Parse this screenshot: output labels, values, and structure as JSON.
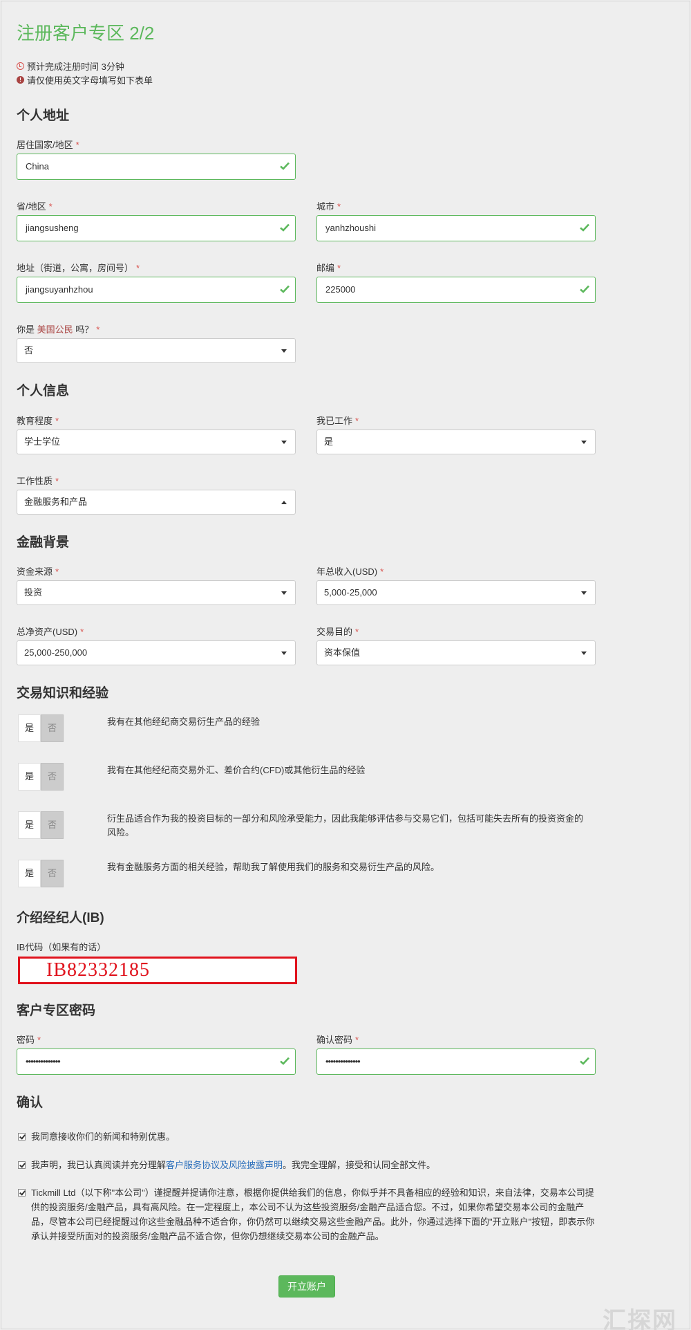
{
  "header": {
    "title": "注册客户专区 2/2",
    "notes": [
      "预计完成注册时间 3分钟",
      "请仅使用英文字母填写如下表单"
    ]
  },
  "address": {
    "title": "个人地址",
    "country_label": "居住国家/地区",
    "country_value": "China",
    "province_label": "省/地区",
    "province_value": "jiangsusheng",
    "city_label": "城市",
    "city_value": "yanhzhoushi",
    "street_label": "地址（街道，公寓，房间号）",
    "street_value": "jiangsuyanhzhou",
    "zip_label": "邮编",
    "zip_value": "225000",
    "us_citizen_label_prefix": "你是",
    "us_citizen_link": "美国公民",
    "us_citizen_label_suffix": "吗？",
    "us_citizen_value": "否"
  },
  "personal_info": {
    "title": "个人信息",
    "education_label": "教育程度",
    "education_value": "学士学位",
    "employed_label": "我已工作",
    "employed_value": "是",
    "job_label": "工作性质",
    "job_value": "金融服务和产品"
  },
  "financial": {
    "title": "金融背景",
    "source_label": "资金来源",
    "source_value": "投资",
    "income_label": "年总收入(USD)",
    "income_value": "5,000-25,000",
    "networth_label": "总净资产(USD)",
    "networth_value": "25,000-250,000",
    "purpose_label": "交易目的",
    "purpose_value": "资本保值"
  },
  "experience": {
    "title": "交易知识和经验",
    "yes_label": "是",
    "no_label": "否",
    "items": [
      "我有在其他经纪商交易衍生产品的经验",
      "我有在其他经纪商交易外汇、差价合约(CFD)或其他衍生品的经验",
      "衍生品适合作为我的投资目标的一部分和风险承受能力，因此我能够评估参与交易它们，包括可能失去所有的投资资金的风险。",
      "我有金融服务方面的相关经验，帮助我了解使用我们的服务和交易衍生产品的风险。"
    ]
  },
  "ib": {
    "title": "介绍经纪人(IB)",
    "code_label": "IB代码（如果有的话）",
    "code_value": "IB82332185"
  },
  "password": {
    "title": "客户专区密码",
    "password_label": "密码",
    "password_value": "••••••••••••••",
    "confirm_label": "确认密码",
    "confirm_value": "••••••••••••••"
  },
  "confirm": {
    "title": "确认",
    "item1": "我同意接收你们的新闻和特别优惠。",
    "item2_prefix": "我声明，我已认真阅读并充分理解",
    "item2_link": "客户服务协议及风险披露声明",
    "item2_suffix": "。我完全理解，接受和认同全部文件。",
    "item3": "Tickmill Ltd（以下称\"本公司\"）谨提醒并提请你注意，根据你提供给我们的信息，你似乎并不具备相应的经验和知识，来自法律，交易本公司提供的投资服务/金融产品，具有高风险。在一定程度上，本公司不认为这些投资服务/金融产品适合您。不过，如果你希望交易本公司的金融产品，尽管本公司已经提醒过你这些金融品种不适合你，你仍然可以继续交易这些金融产品。此外，你通过选择下面的\"开立账户\"按钮，即表示你承认并接受所面对的投资服务/金融产品不适合你，但你仍想继续交易本公司的金融产品。"
  },
  "submit_label": "开立账户",
  "watermark": "汇探网",
  "colors": {
    "accent_green": "#5cb85c",
    "required_red": "#d9534f",
    "link_blue": "#2a6ebb",
    "highlight_red": "#e0121c"
  }
}
